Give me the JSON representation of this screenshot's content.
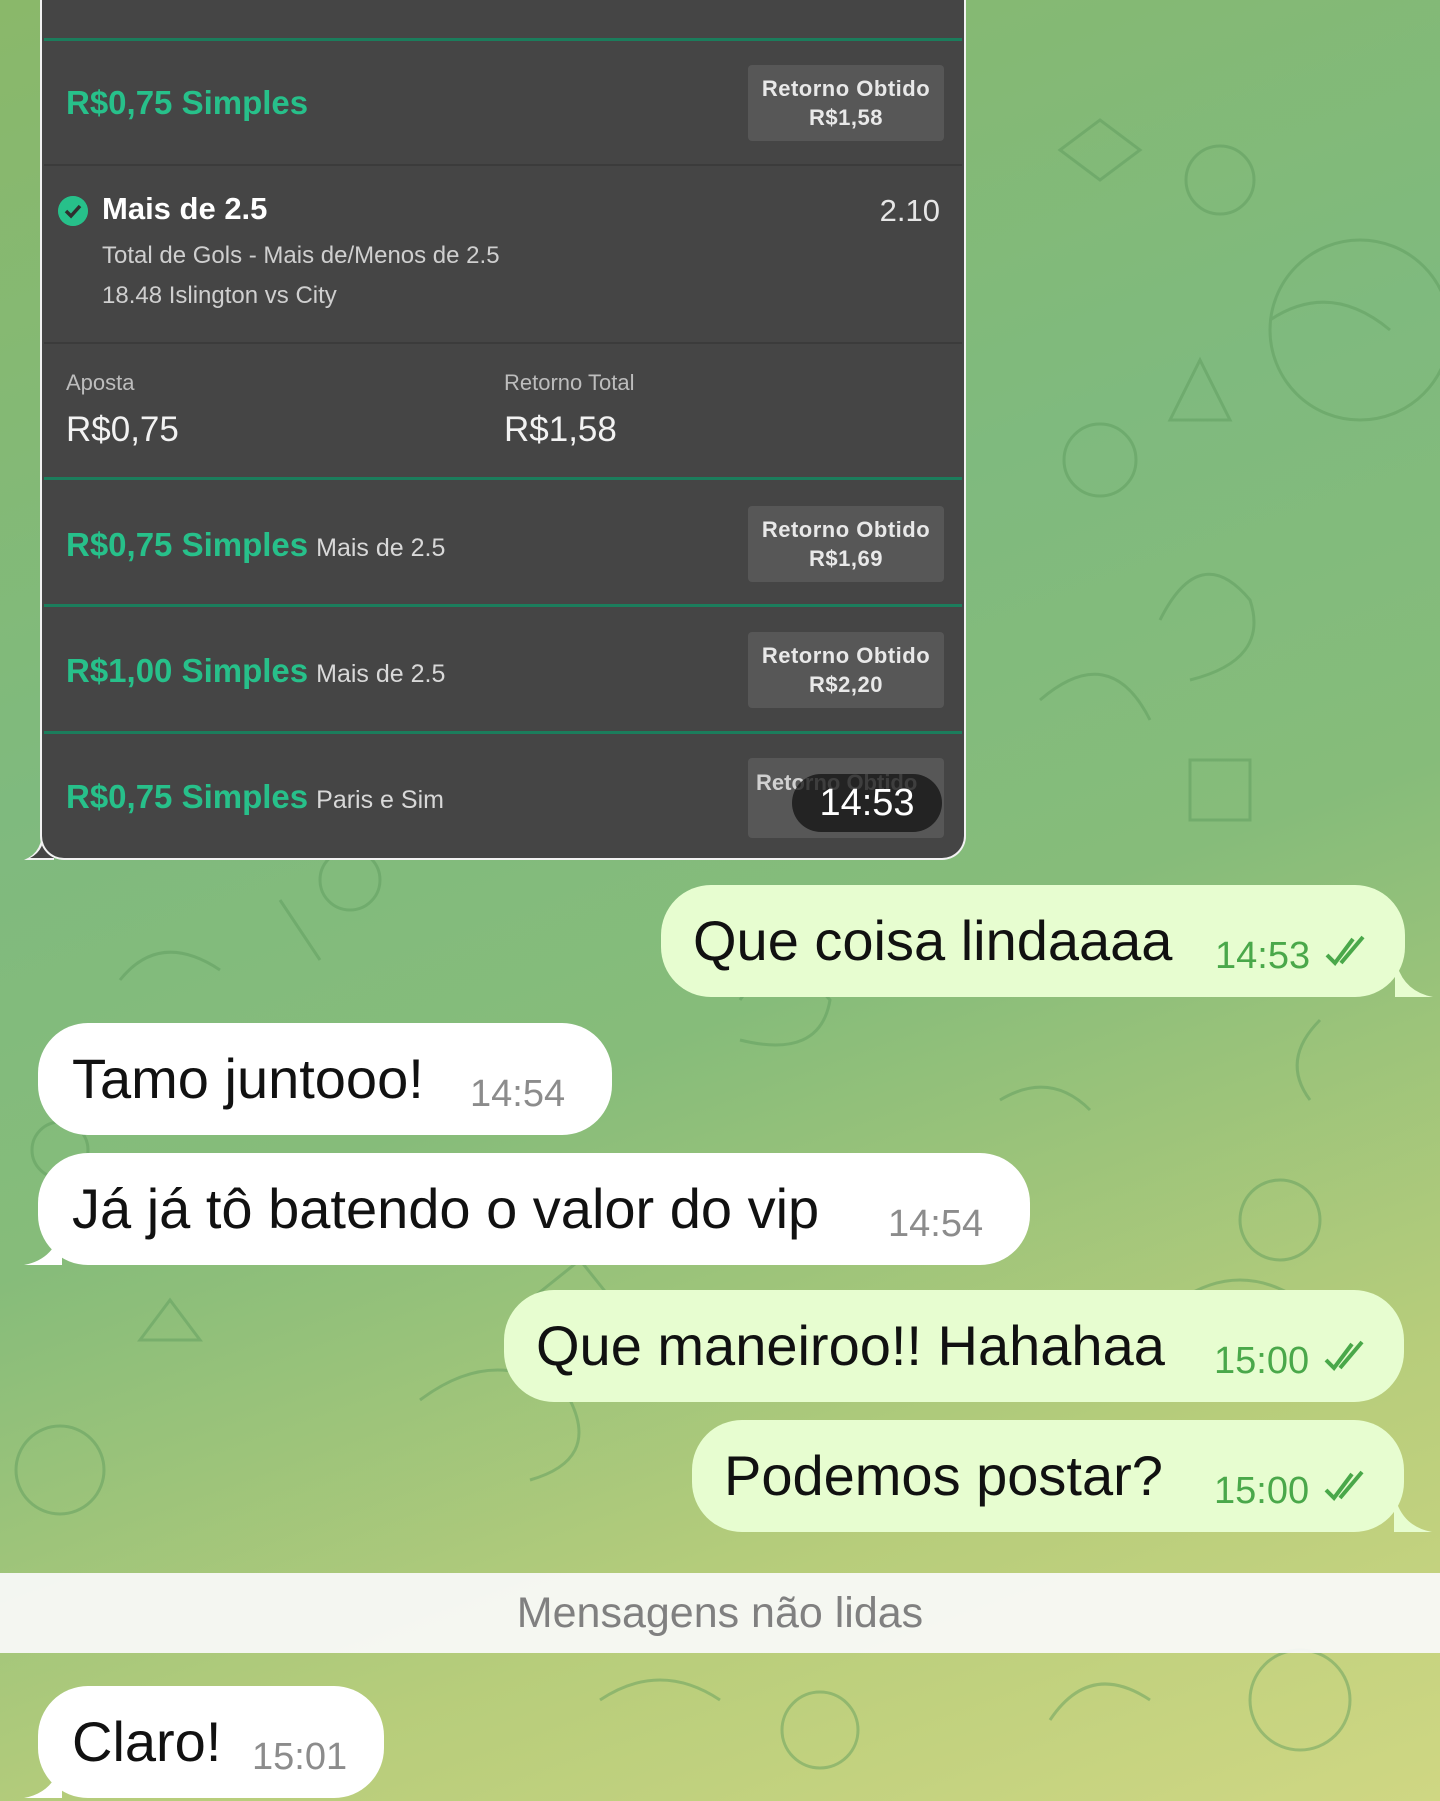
{
  "screenshot": {
    "bets": [
      {
        "title": "R$0,75 Simples",
        "subtitle": "",
        "return_label": "Retorno Obtido",
        "return_value": "R$1,58"
      },
      {
        "title": "R$0,75 Simples",
        "subtitle": "Mais de 2.5",
        "return_label": "Retorno Obtido",
        "return_value": "R$1,69"
      },
      {
        "title": "R$1,00 Simples",
        "subtitle": "Mais de 2.5",
        "return_label": "Retorno Obtido",
        "return_value": "R$2,20"
      },
      {
        "title": "R$0,75 Simples",
        "subtitle": "Paris e Sim",
        "return_label": "Retorno Obtido",
        "return_value": ""
      }
    ],
    "selection": {
      "name": "Mais de 2.5",
      "odds": "2.10",
      "market": "Total de Gols - Mais de/Menos de 2.5",
      "event": "18.48 Islington vs City"
    },
    "stake_label": "Aposta",
    "stake_value": "R$0,75",
    "total_return_label": "Retorno Total",
    "total_return_value": "R$1,58",
    "partial_return_text": "Retorno Obtido",
    "time": "14:53"
  },
  "messages": [
    {
      "dir": "out",
      "text": "Que coisa lindaaaa",
      "time": "14:53",
      "read": true
    },
    {
      "dir": "in",
      "text": "Tamo juntooo!",
      "time": "14:54"
    },
    {
      "dir": "in",
      "text": "Já já tô batendo o valor do vip",
      "time": "14:54"
    },
    {
      "dir": "out",
      "text": "Que maneiroo!! Hahahaa",
      "time": "15:00",
      "read": true
    },
    {
      "dir": "out",
      "text": "Podemos postar?",
      "time": "15:00",
      "read": true
    }
  ],
  "unread_divider": "Mensagens não lidas",
  "after_unread": [
    {
      "dir": "in",
      "text": "Claro!",
      "time": "15:01"
    }
  ],
  "colors": {
    "outgoing_bubble": "#e7fdd0",
    "incoming_bubble": "#ffffff",
    "bet_green": "#27c08a",
    "screenshot_bg": "#454545"
  }
}
